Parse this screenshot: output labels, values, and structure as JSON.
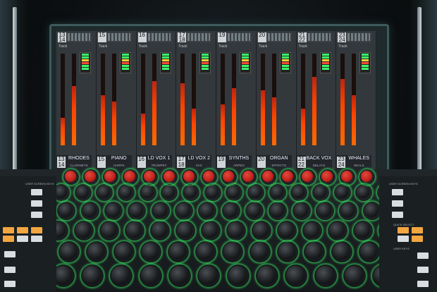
{
  "scene": {
    "alt": "Close-up photograph of a digital mixing console with a channel display screen and rows of rotary knobs"
  },
  "display": {
    "strips": [
      {
        "top_num": "13\n14",
        "track": "Track",
        "footer_num": "13\n14",
        "name": "RHODES",
        "sub": "CLARINETS",
        "fill_a": 0.3,
        "fill_b": 0.65
      },
      {
        "top_num": "15",
        "track": "Track",
        "footer_num": "15",
        "name": "PIANO",
        "sub": "HARPS",
        "fill_a": 0.55,
        "fill_b": 0.48
      },
      {
        "top_num": "16",
        "track": "Track",
        "footer_num": "16",
        "name": "LD VOX 1",
        "sub": "TRUMPET",
        "fill_a": 0.35,
        "fill_b": 0.7
      },
      {
        "top_num": "17\n18",
        "track": "Track",
        "footer_num": "17\n18",
        "name": "LD VOX 2",
        "sub": "SAX",
        "fill_a": 0.68,
        "fill_b": 0.4
      },
      {
        "top_num": "19",
        "track": "Track",
        "footer_num": "19",
        "name": "SYNTHS",
        "sub": "ARPEG",
        "fill_a": 0.45,
        "fill_b": 0.62
      },
      {
        "top_num": "20",
        "track": "Track",
        "footer_num": "20",
        "name": "ORGAN",
        "sub": "EFFECTS",
        "fill_a": 0.6,
        "fill_b": 0.52
      },
      {
        "top_num": "21\n22",
        "track": "Track",
        "footer_num": "21\n22",
        "name": "BACK VOX",
        "sub": "DELAYS",
        "fill_a": 0.4,
        "fill_b": 0.75
      },
      {
        "top_num": "23\n24",
        "track": "Track",
        "footer_num": "23\n24",
        "name": "WHALES",
        "sub": "SEALS",
        "fill_a": 0.72,
        "fill_b": 0.55
      }
    ]
  },
  "console": {
    "left_label": "USER SCREEN KEYS",
    "right_label": "USER SCREEN KEYS",
    "quick_select": "QUICK SELECT",
    "user_keys": "USER KEYS"
  },
  "colors": {
    "meter": "#ff5a00",
    "knob_red": "#c2201a",
    "knob_black": "#1a1c1e",
    "ring_green": "#3cff6a",
    "btn_orange": "#f2a640"
  }
}
